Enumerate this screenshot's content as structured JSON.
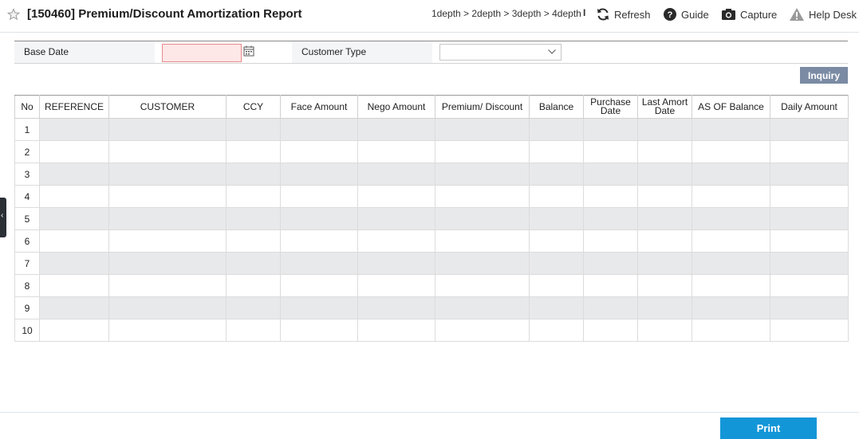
{
  "header": {
    "title": "[150460] Premium/Discount Amortization Report",
    "breadcrumb": "1depth > 2depth > 3depth > 4depth",
    "separator": "I",
    "tools": {
      "refresh": "Refresh",
      "guide": "Guide",
      "capture": "Capture",
      "helpdesk": "Help Desk"
    }
  },
  "search": {
    "base_date_label": "Base Date",
    "base_date_value": "",
    "customer_type_label": "Customer Type",
    "customer_type_value": ""
  },
  "buttons": {
    "inquiry": "Inquiry",
    "print": "Print"
  },
  "table": {
    "columns": [
      "No",
      "REFERENCE",
      "CUSTOMER",
      "CCY",
      "Face Amount",
      "Nego Amount",
      "Premium/ Discount",
      "Balance",
      "Purchase Date",
      "Last Amort Date",
      "AS OF Balance",
      "Daily Amount"
    ],
    "row_numbers": [
      "1",
      "2",
      "3",
      "4",
      "5",
      "6",
      "7",
      "8",
      "9",
      "10"
    ]
  },
  "side_tab_glyph": "‹",
  "colors": {
    "accent": "#1396d8",
    "inquiry_button": "#7b8ba3",
    "required_field": "#fde7e7",
    "alt_row": "#e8e9eb"
  }
}
